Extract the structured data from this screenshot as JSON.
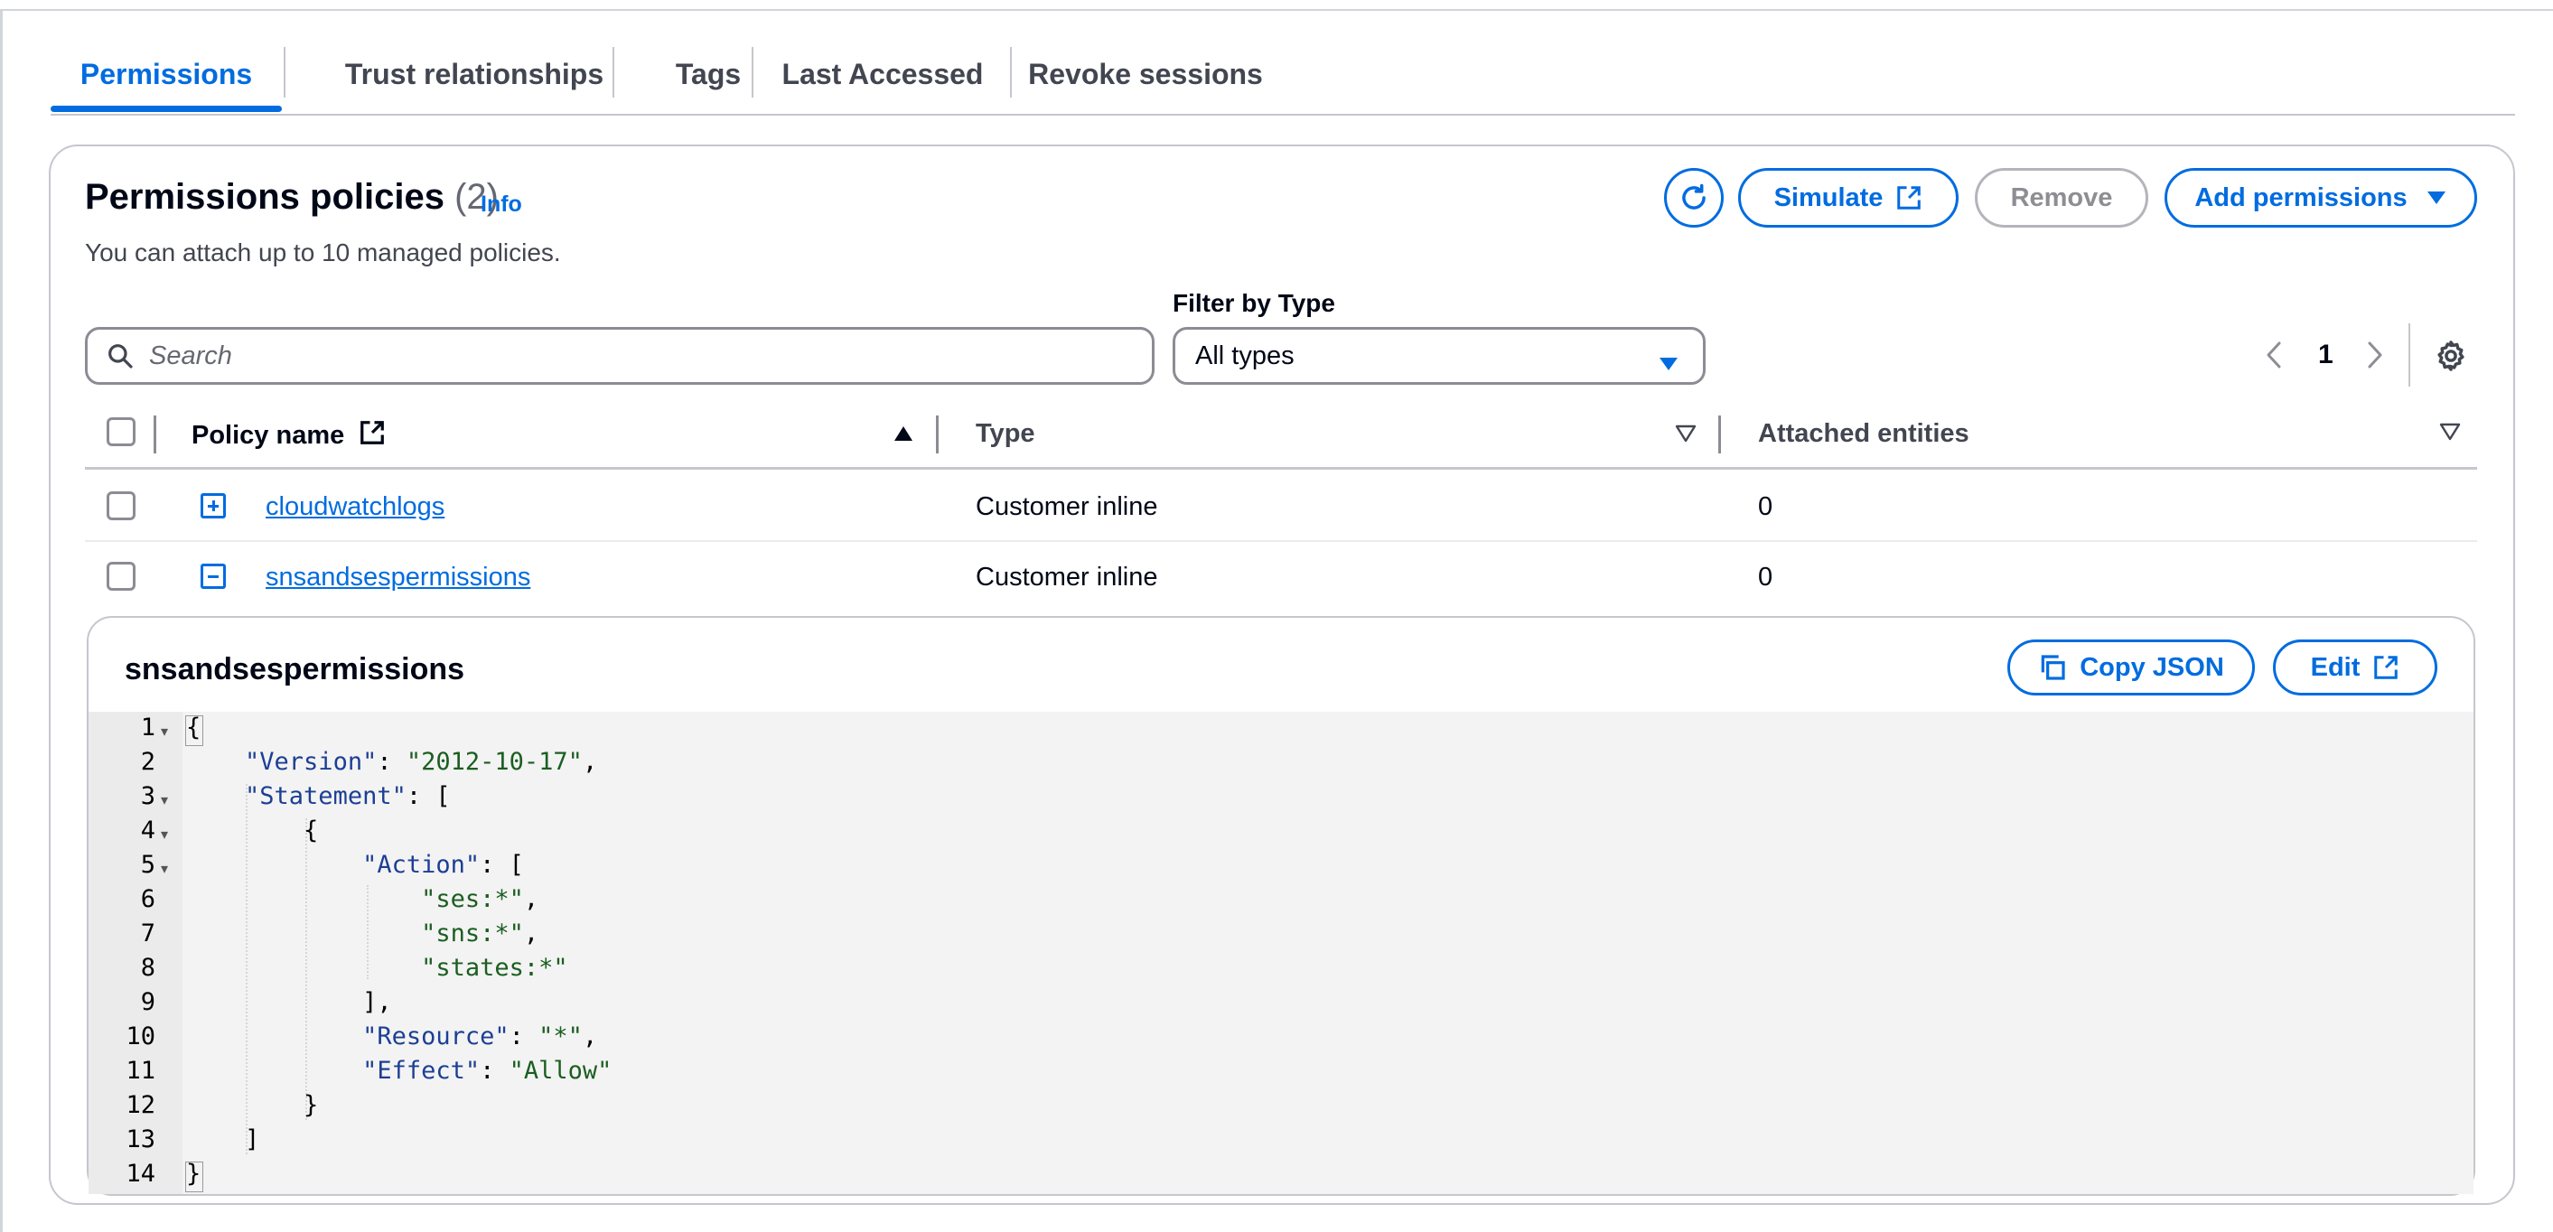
{
  "tabs": [
    {
      "label": "Permissions",
      "active": true
    },
    {
      "label": "Trust relationships",
      "active": false
    },
    {
      "label": "Tags",
      "active": false
    },
    {
      "label": "Last Accessed",
      "active": false
    },
    {
      "label": "Revoke sessions",
      "active": false
    }
  ],
  "header": {
    "title": "Permissions policies",
    "count": "(2)",
    "info": "Info",
    "description": "You can attach up to 10 managed policies."
  },
  "actions": {
    "refresh_icon": "refresh-icon",
    "simulate": "Simulate",
    "remove": "Remove",
    "add_permissions": "Add permissions"
  },
  "filter": {
    "search_placeholder": "Search",
    "type_label": "Filter by Type",
    "type_value": "All types"
  },
  "pagination": {
    "current_page": "1"
  },
  "table": {
    "columns": [
      "Policy name",
      "Type",
      "Attached entities"
    ],
    "rows": [
      {
        "name": "cloudwatchlogs",
        "type": "Customer inline",
        "attached": "0",
        "expanded": false
      },
      {
        "name": "snsandsespermissions",
        "type": "Customer inline",
        "attached": "0",
        "expanded": true
      }
    ]
  },
  "details": {
    "title": "snsandsespermissions",
    "copy_json": "Copy JSON",
    "edit": "Edit",
    "line_numbers": [
      "1",
      "2",
      "3",
      "4",
      "5",
      "6",
      "7",
      "8",
      "9",
      "10",
      "11",
      "12",
      "13",
      "14"
    ],
    "json": {
      "key_version": "\"Version\"",
      "val_version": "\"2012-10-17\"",
      "key_statement": "\"Statement\"",
      "key_action": "\"Action\"",
      "val_ses": "\"ses:*\"",
      "val_sns": "\"sns:*\"",
      "val_states": "\"states:*\"",
      "key_resource": "\"Resource\"",
      "val_resource": "\"*\"",
      "key_effect": "\"Effect\"",
      "val_effect": "\"Allow\""
    }
  },
  "colors": {
    "accent": "#006ce0",
    "border": "#c6c6cd",
    "code_bg": "#f3f3f3",
    "json_key": "#1c3f95",
    "json_string": "#1b5e20"
  }
}
